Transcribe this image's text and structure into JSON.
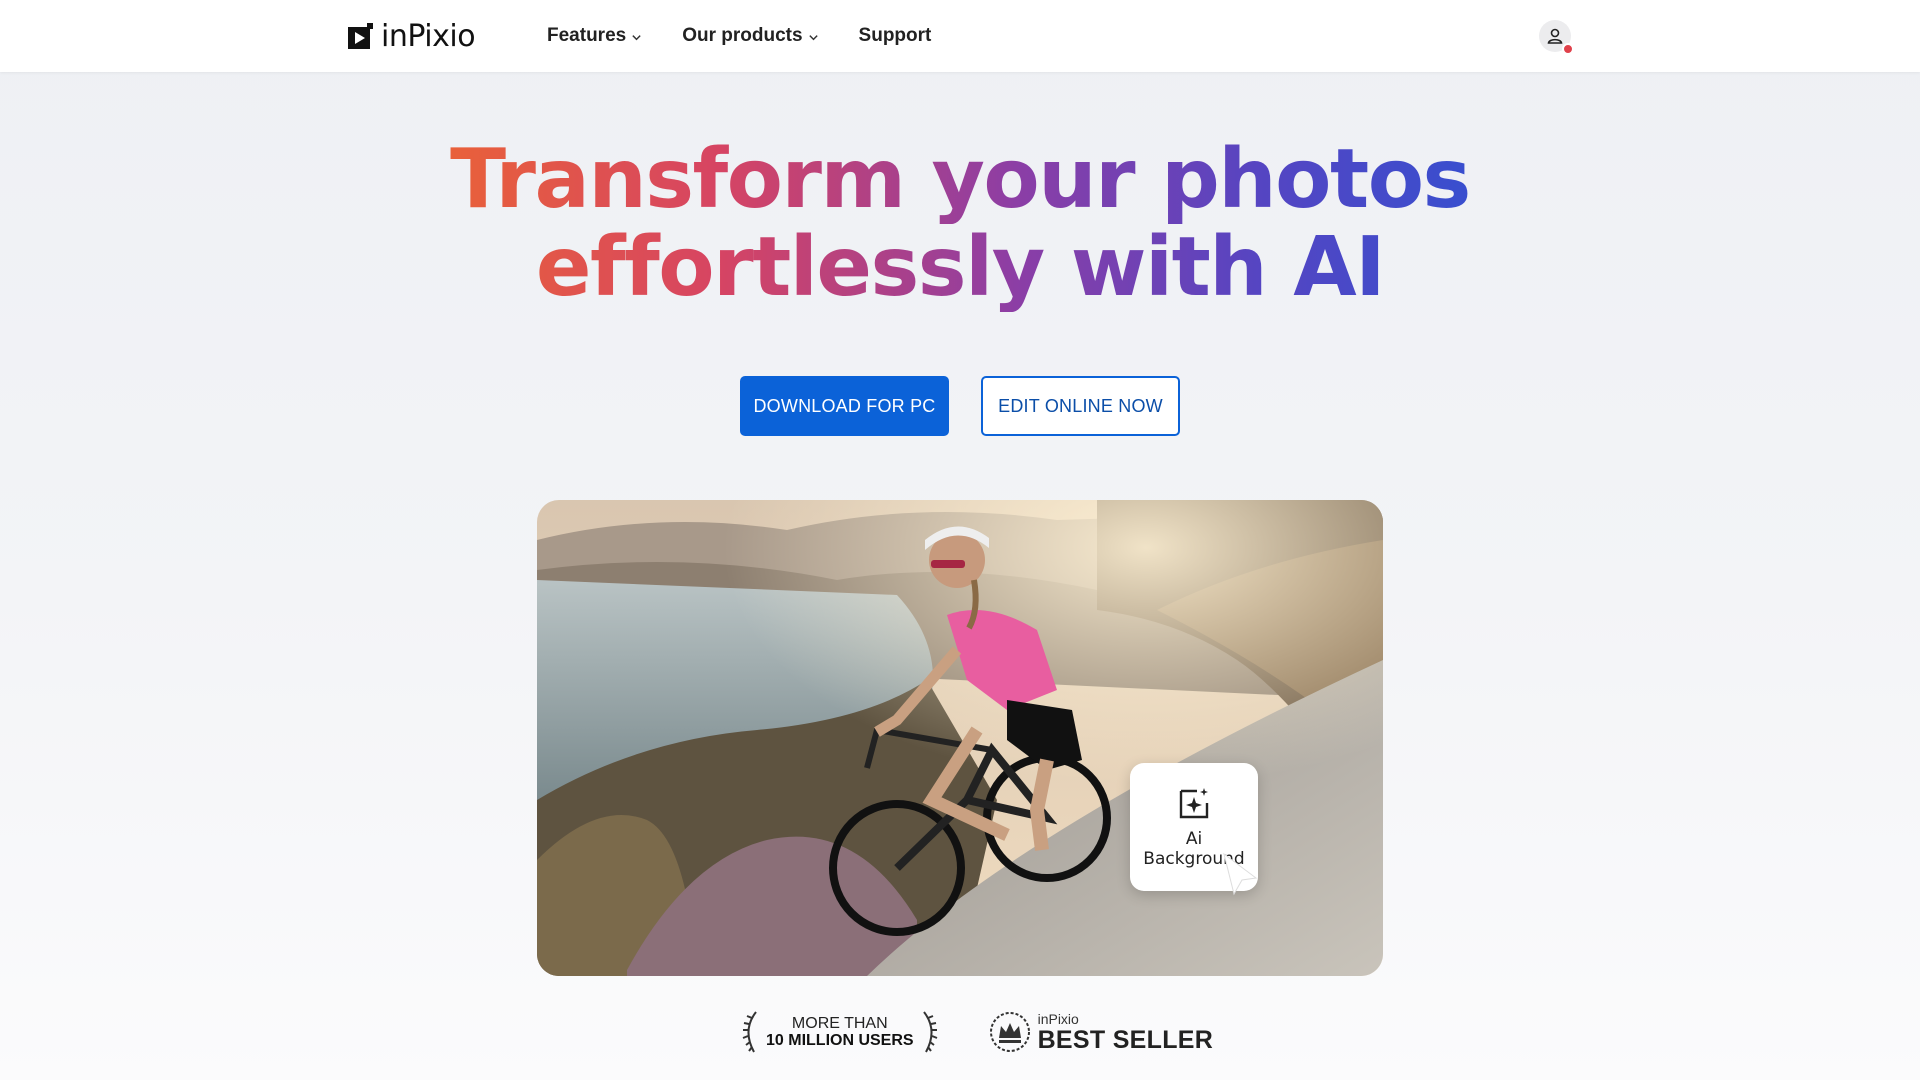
{
  "header": {
    "logo_text": "inPixio",
    "nav": [
      {
        "label": "Features",
        "has_dropdown": true
      },
      {
        "label": "Our products",
        "has_dropdown": true
      },
      {
        "label": "Support",
        "has_dropdown": false
      }
    ],
    "account_icon": "user-icon"
  },
  "hero": {
    "title_line1": "Transform your photos",
    "title_line2": "effortlessly with AI",
    "gradient_colors": [
      "#ef6a2c",
      "#d64463",
      "#8b3ea6",
      "#5545c2",
      "#2c52d4"
    ],
    "primary_button": "DOWNLOAD FOR PC",
    "secondary_button": "EDIT ONLINE NOW"
  },
  "photo": {
    "ai_card_line1": "Ai",
    "ai_card_line2": "Background",
    "ai_card_icon": "ai-sparkle-image-icon",
    "cursor_icon": "pointer-cursor-icon"
  },
  "badges": {
    "users_line1": "MORE THAN",
    "users_line2": "10 MILLION USERS",
    "best_line1": "inPixio",
    "best_line2": "BEST SELLER"
  },
  "colors": {
    "primary": "#0b62d8",
    "badge_red": "#e0414b"
  }
}
